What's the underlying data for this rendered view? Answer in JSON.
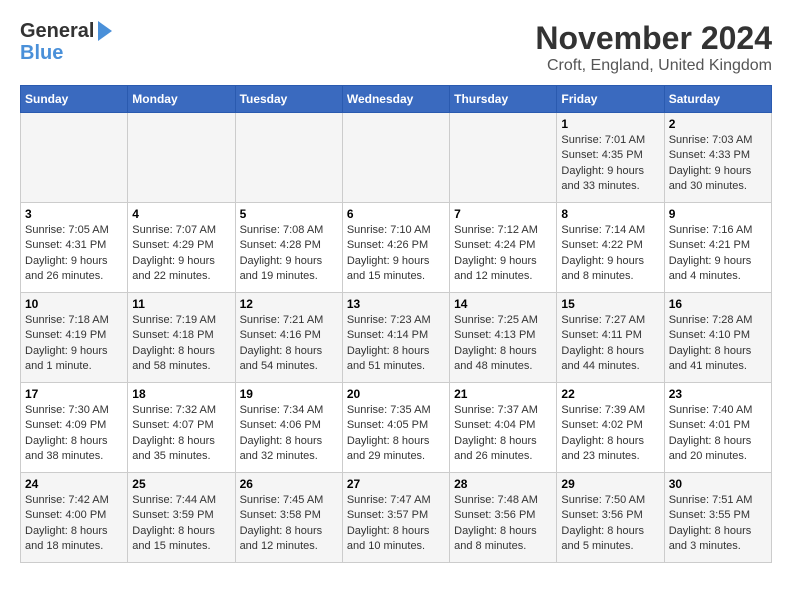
{
  "logo": {
    "general": "General",
    "blue": "Blue"
  },
  "title": "November 2024",
  "subtitle": "Croft, England, United Kingdom",
  "days_of_week": [
    "Sunday",
    "Monday",
    "Tuesday",
    "Wednesday",
    "Thursday",
    "Friday",
    "Saturday"
  ],
  "weeks": [
    [
      {
        "day": "",
        "info": ""
      },
      {
        "day": "",
        "info": ""
      },
      {
        "day": "",
        "info": ""
      },
      {
        "day": "",
        "info": ""
      },
      {
        "day": "",
        "info": ""
      },
      {
        "day": "1",
        "info": "Sunrise: 7:01 AM\nSunset: 4:35 PM\nDaylight: 9 hours and 33 minutes."
      },
      {
        "day": "2",
        "info": "Sunrise: 7:03 AM\nSunset: 4:33 PM\nDaylight: 9 hours and 30 minutes."
      }
    ],
    [
      {
        "day": "3",
        "info": "Sunrise: 7:05 AM\nSunset: 4:31 PM\nDaylight: 9 hours and 26 minutes."
      },
      {
        "day": "4",
        "info": "Sunrise: 7:07 AM\nSunset: 4:29 PM\nDaylight: 9 hours and 22 minutes."
      },
      {
        "day": "5",
        "info": "Sunrise: 7:08 AM\nSunset: 4:28 PM\nDaylight: 9 hours and 19 minutes."
      },
      {
        "day": "6",
        "info": "Sunrise: 7:10 AM\nSunset: 4:26 PM\nDaylight: 9 hours and 15 minutes."
      },
      {
        "day": "7",
        "info": "Sunrise: 7:12 AM\nSunset: 4:24 PM\nDaylight: 9 hours and 12 minutes."
      },
      {
        "day": "8",
        "info": "Sunrise: 7:14 AM\nSunset: 4:22 PM\nDaylight: 9 hours and 8 minutes."
      },
      {
        "day": "9",
        "info": "Sunrise: 7:16 AM\nSunset: 4:21 PM\nDaylight: 9 hours and 4 minutes."
      }
    ],
    [
      {
        "day": "10",
        "info": "Sunrise: 7:18 AM\nSunset: 4:19 PM\nDaylight: 9 hours and 1 minute."
      },
      {
        "day": "11",
        "info": "Sunrise: 7:19 AM\nSunset: 4:18 PM\nDaylight: 8 hours and 58 minutes."
      },
      {
        "day": "12",
        "info": "Sunrise: 7:21 AM\nSunset: 4:16 PM\nDaylight: 8 hours and 54 minutes."
      },
      {
        "day": "13",
        "info": "Sunrise: 7:23 AM\nSunset: 4:14 PM\nDaylight: 8 hours and 51 minutes."
      },
      {
        "day": "14",
        "info": "Sunrise: 7:25 AM\nSunset: 4:13 PM\nDaylight: 8 hours and 48 minutes."
      },
      {
        "day": "15",
        "info": "Sunrise: 7:27 AM\nSunset: 4:11 PM\nDaylight: 8 hours and 44 minutes."
      },
      {
        "day": "16",
        "info": "Sunrise: 7:28 AM\nSunset: 4:10 PM\nDaylight: 8 hours and 41 minutes."
      }
    ],
    [
      {
        "day": "17",
        "info": "Sunrise: 7:30 AM\nSunset: 4:09 PM\nDaylight: 8 hours and 38 minutes."
      },
      {
        "day": "18",
        "info": "Sunrise: 7:32 AM\nSunset: 4:07 PM\nDaylight: 8 hours and 35 minutes."
      },
      {
        "day": "19",
        "info": "Sunrise: 7:34 AM\nSunset: 4:06 PM\nDaylight: 8 hours and 32 minutes."
      },
      {
        "day": "20",
        "info": "Sunrise: 7:35 AM\nSunset: 4:05 PM\nDaylight: 8 hours and 29 minutes."
      },
      {
        "day": "21",
        "info": "Sunrise: 7:37 AM\nSunset: 4:04 PM\nDaylight: 8 hours and 26 minutes."
      },
      {
        "day": "22",
        "info": "Sunrise: 7:39 AM\nSunset: 4:02 PM\nDaylight: 8 hours and 23 minutes."
      },
      {
        "day": "23",
        "info": "Sunrise: 7:40 AM\nSunset: 4:01 PM\nDaylight: 8 hours and 20 minutes."
      }
    ],
    [
      {
        "day": "24",
        "info": "Sunrise: 7:42 AM\nSunset: 4:00 PM\nDaylight: 8 hours and 18 minutes."
      },
      {
        "day": "25",
        "info": "Sunrise: 7:44 AM\nSunset: 3:59 PM\nDaylight: 8 hours and 15 minutes."
      },
      {
        "day": "26",
        "info": "Sunrise: 7:45 AM\nSunset: 3:58 PM\nDaylight: 8 hours and 12 minutes."
      },
      {
        "day": "27",
        "info": "Sunrise: 7:47 AM\nSunset: 3:57 PM\nDaylight: 8 hours and 10 minutes."
      },
      {
        "day": "28",
        "info": "Sunrise: 7:48 AM\nSunset: 3:56 PM\nDaylight: 8 hours and 8 minutes."
      },
      {
        "day": "29",
        "info": "Sunrise: 7:50 AM\nSunset: 3:56 PM\nDaylight: 8 hours and 5 minutes."
      },
      {
        "day": "30",
        "info": "Sunrise: 7:51 AM\nSunset: 3:55 PM\nDaylight: 8 hours and 3 minutes."
      }
    ]
  ]
}
